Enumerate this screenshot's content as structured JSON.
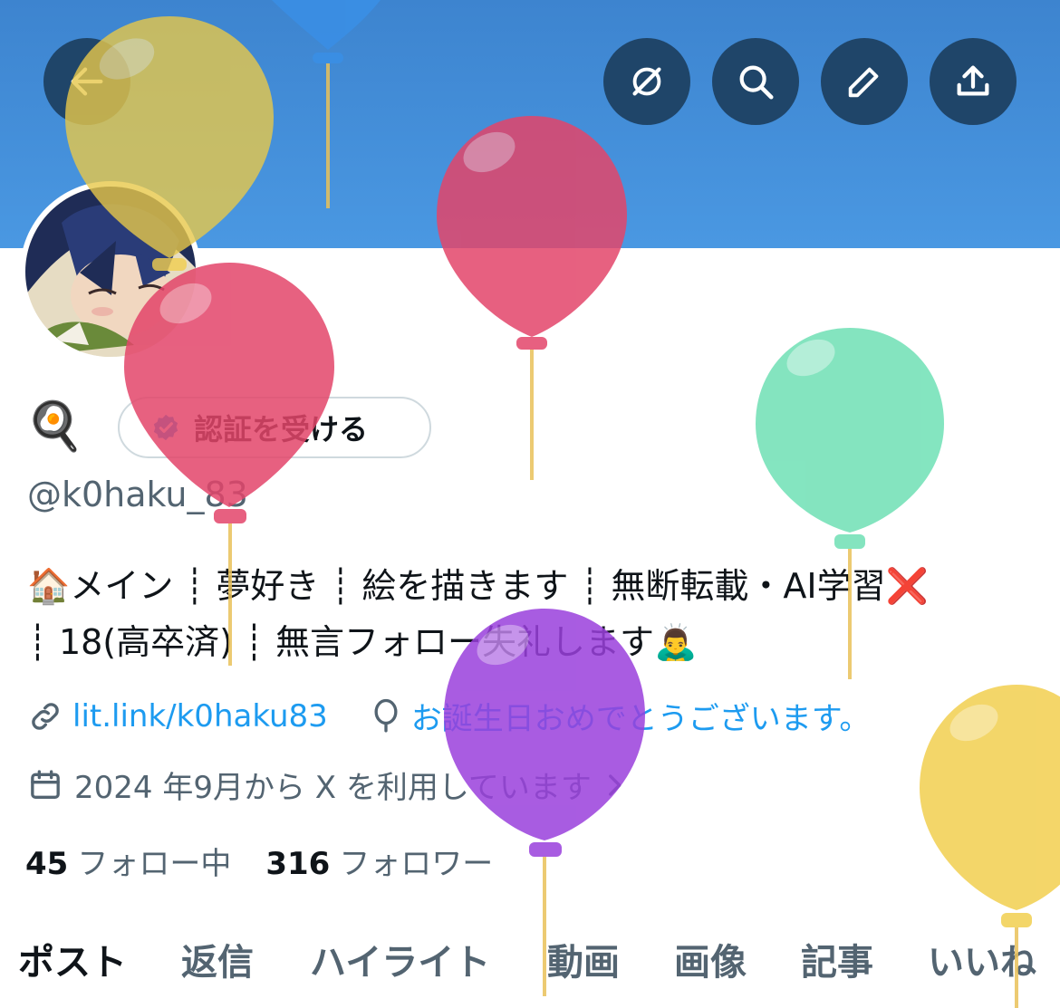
{
  "header": {
    "back_icon": "arrow-left-icon",
    "actions": [
      {
        "name": "grok-icon"
      },
      {
        "name": "search-icon"
      },
      {
        "name": "edit-icon"
      },
      {
        "name": "share-icon"
      }
    ]
  },
  "profile": {
    "name_emoji": "🍳",
    "verify_label": "認証を受ける",
    "handle": "@k0haku_83",
    "bio_line1": "🏠メイン ┊ 夢好き ┊ 絵を描きます ┊ 無断転載・AI学習❌",
    "bio_line2": "┊ 18(高卒済) ┊ 無言フォロー失礼します🙇‍♂️",
    "link": "lit.link/k0haku83",
    "birthday": "お誕生日おめでとうございます。",
    "joined": "2024 年9月から X を利用しています",
    "following_count": "45",
    "following_label": "フォロー中",
    "followers_count": "316",
    "followers_label": "フォロワー"
  },
  "tabs": [
    {
      "label": "ポスト",
      "active": true
    },
    {
      "label": "返信",
      "active": false
    },
    {
      "label": "ハイライト",
      "active": false
    },
    {
      "label": "動画",
      "active": false
    },
    {
      "label": "画像",
      "active": false
    },
    {
      "label": "記事",
      "active": false
    },
    {
      "label": "いいね",
      "active": false
    }
  ],
  "colors": {
    "banner": "#4a98e2",
    "button": "#1f4569",
    "link": "#1d9bf0",
    "balloon_yellow": "#e7c84a",
    "balloon_red": "#e3456a",
    "balloon_green": "#6fe0b5",
    "balloon_purple": "#9a40dc"
  }
}
